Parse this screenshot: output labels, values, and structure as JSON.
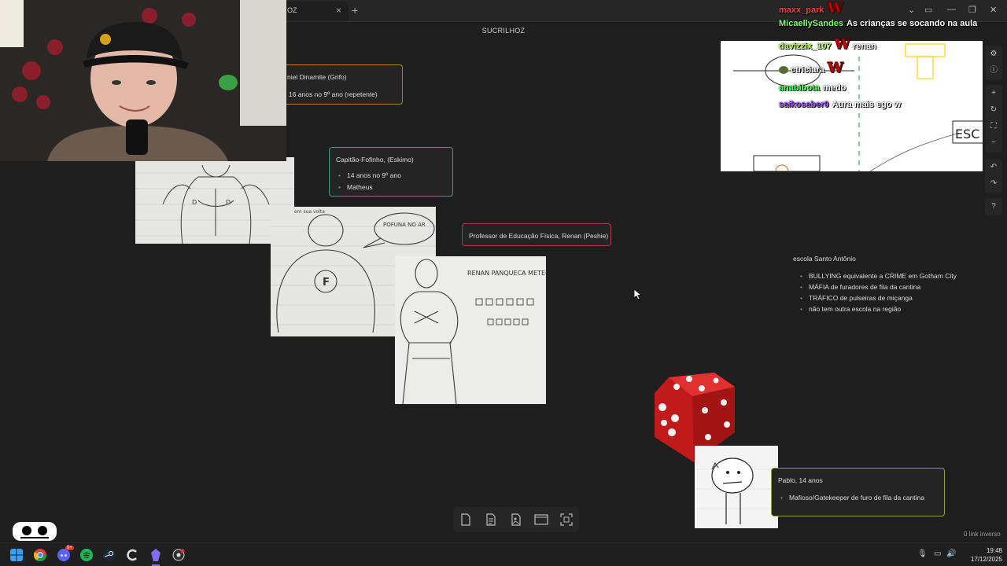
{
  "app": {
    "tab_title": "OZ",
    "tab_close": "×",
    "tab_new": "+",
    "canvas_title": "SUCRILHOZ"
  },
  "cards": {
    "daniel": {
      "title": "niel Dinamite (Grifo)",
      "items": [
        "16 anos no 9º ano (repetente)"
      ],
      "border": "#a8823b"
    },
    "capitao": {
      "title": "Capitão-Fofinho, (Eskimo)",
      "items": [
        "14 anos no 9º ano",
        "Matheus"
      ],
      "border": "#3c9b86"
    },
    "professor": {
      "title": "Professor de Educação Física, Renan (Peshie)",
      "border": "#b0364a"
    },
    "pablo": {
      "title": "Pablo, 14 anos",
      "items": [
        "Mafioso/Gatekeeper de furo de fila da cantina"
      ],
      "border": "#8fa13d"
    }
  },
  "school_note": {
    "title": "escola Santo Antônio",
    "items": [
      "BULLYING equivalente a CRIME em Gotham City",
      "MÁFIA de furadores de fila da cantina",
      "TRÁFICO de pulseiras de miçanga",
      "não tem outra escola na região"
    ]
  },
  "sketch_text": {
    "bubble": "POFUNA NO AR",
    "top_caption": "em sua volta",
    "shirt_letter": "F",
    "renan_title": "RENAN PANQUECA METEORO-MAN"
  },
  "chat": [
    {
      "user": "maxx_park",
      "user_color": "#ff3b3b",
      "msg": "",
      "emote": "W"
    },
    {
      "user": "MicaellySandes",
      "user_color": "#7dff6b",
      "msg": "As crianças se socando na aula",
      "emote": ""
    },
    {
      "user": "davizzix_107",
      "user_color": "#b8ff4a",
      "msg": "renan",
      "emote": "W"
    },
    {
      "user": "ctriciara",
      "user_color": "#ffffff",
      "msg": "",
      "emote": "W"
    },
    {
      "user": "anabibota",
      "user_color": "#59ff59",
      "msg": "medo",
      "emote": ""
    },
    {
      "user": "saikosaber0",
      "user_color": "#9a4dff",
      "msg": "Aura mais ego w",
      "emote": ""
    }
  ],
  "whiteboard_text": "ESC",
  "status": {
    "backlinks": "0 link inverso"
  },
  "clock": {
    "time": "19:48",
    "date": "17/12/2025"
  },
  "taskbar_badge": "9+",
  "colors": {
    "background": "#1e1e1e",
    "chrome": "#262626",
    "accent": "#7f6df2"
  }
}
